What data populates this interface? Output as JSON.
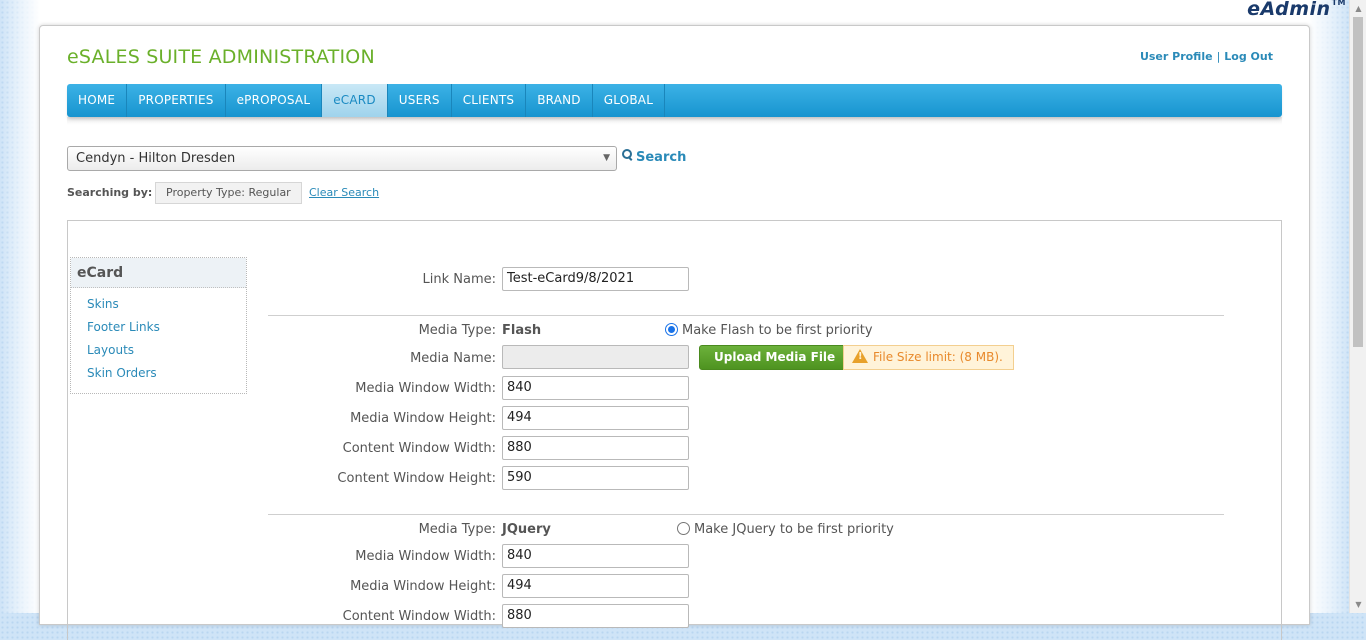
{
  "brand": {
    "logo": "eAdmin",
    "trademark": "TM"
  },
  "header": {
    "app_title": "eSALES SUITE ADMINISTRATION",
    "user_profile": "User Profile",
    "separator": "|",
    "log_out": "Log Out"
  },
  "nav": {
    "items": [
      {
        "label": "HOME"
      },
      {
        "label": "PROPERTIES"
      },
      {
        "label": "ePROPOSAL"
      },
      {
        "label": "eCARD",
        "active": true
      },
      {
        "label": "USERS"
      },
      {
        "label": "CLIENTS"
      },
      {
        "label": "BRAND"
      },
      {
        "label": "GLOBAL"
      }
    ]
  },
  "search": {
    "property_value": "Cendyn - Hilton Dresden",
    "button_label": "Search",
    "searching_by_label": "Searching by:",
    "filter": "Property Type: Regular",
    "clear_label": "Clear Search"
  },
  "sidebar": {
    "title": "eCard",
    "items": [
      {
        "label": "Skins"
      },
      {
        "label": "Footer Links"
      },
      {
        "label": "Layouts"
      },
      {
        "label": "Skin Orders"
      }
    ]
  },
  "form": {
    "link_name_label": "Link Name:",
    "link_name_value": "Test-eCard9/8/2021",
    "flash": {
      "media_type_label": "Media Type:",
      "media_type_value": "Flash",
      "priority_label": "Make Flash to be first priority",
      "priority_checked": true,
      "media_name_label": "Media Name:",
      "media_name_value": "",
      "upload_label": "Upload Media File",
      "size_limit": "File Size limit: (8 MB).",
      "media_width_label": "Media Window Width:",
      "media_width_value": "840",
      "media_height_label": "Media Window Height:",
      "media_height_value": "494",
      "content_width_label": "Content Window Width:",
      "content_width_value": "880",
      "content_height_label": "Content Window Height:",
      "content_height_value": "590"
    },
    "jquery": {
      "media_type_label": "Media Type:",
      "media_type_value": "JQuery",
      "priority_label": "Make JQuery to be first priority",
      "priority_checked": false,
      "media_width_label": "Media Window Width:",
      "media_width_value": "840",
      "media_height_label": "Media Window Height:",
      "media_height_value": "494",
      "content_width_label": "Content Window Width:",
      "content_width_value": "880"
    }
  }
}
